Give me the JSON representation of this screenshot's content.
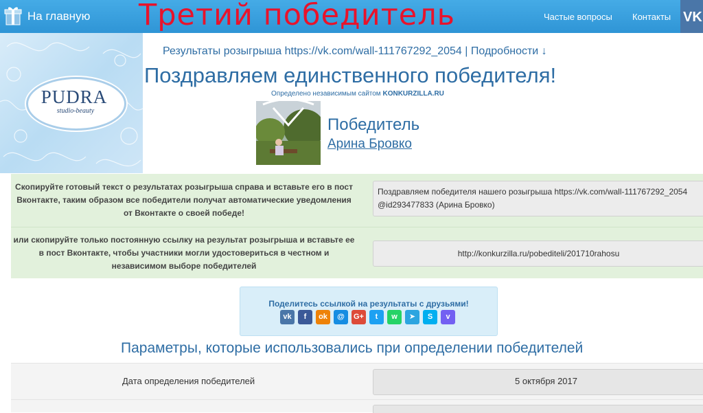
{
  "overlay_title": "Третий победитель",
  "nav": {
    "home_label": "На главную",
    "faq_label": "Частые вопросы",
    "contacts_label": "Контакты"
  },
  "banner": {
    "brand": "PUDRA",
    "subtitle": "studio-beauty"
  },
  "results": {
    "prefix": "Результаты розыгрыша",
    "link": "https://vk.com/wall-111767292_2054",
    "separator": "|",
    "details": "Подробности ↓"
  },
  "congrats": "Поздравляем единственного победителя!",
  "determined": {
    "text": "Определено независимым сайтом",
    "site": "KONKURZILLA.RU"
  },
  "winner": {
    "label": "Победитель",
    "name": "Арина Бровко"
  },
  "copy": {
    "instruction_1": "Скопируйте готовый текст о результатах розыгрыша справа и вставьте его в пост Вконтакте, таким образом все победители получат автоматические уведомления от Вконтакте о своей победе!",
    "text_value": "Поздравляем победителя нашего розыгрыша https://vk.com/wall-111767292_2054 @id293477833 (Арина Бровко)",
    "instruction_2": "или скопируйте только постоянную ссылку на результат розыгрыша и вставьте ее в пост Вконтакте, чтобы участники могли удостовериться в честном и независимом выборе победителей",
    "link_value": "http://konkurzilla.ru/pobediteli/201710rahosu"
  },
  "share": {
    "title": "Поделитесь ссылкой на результаты с друзьями!",
    "icons": [
      {
        "name": "vk-icon",
        "glyph": "vk",
        "color": "#4a76a8"
      },
      {
        "name": "facebook-icon",
        "glyph": "f",
        "color": "#3b5998"
      },
      {
        "name": "odnoklassniki-icon",
        "glyph": "ok",
        "color": "#ee8208"
      },
      {
        "name": "moimir-icon",
        "glyph": "@",
        "color": "#168de2"
      },
      {
        "name": "googleplus-icon",
        "glyph": "G+",
        "color": "#dd4b39"
      },
      {
        "name": "twitter-icon",
        "glyph": "t",
        "color": "#1da1f2"
      },
      {
        "name": "whatsapp-icon",
        "glyph": "w",
        "color": "#25d366"
      },
      {
        "name": "telegram-icon",
        "glyph": "➤",
        "color": "#2ca5e0"
      },
      {
        "name": "skype-icon",
        "glyph": "S",
        "color": "#00aff0"
      },
      {
        "name": "viber-icon",
        "glyph": "v",
        "color": "#7360f2"
      }
    ]
  },
  "params": {
    "title": "Параметры, которые использовались при определении победителей",
    "date_label": "Дата определения победителей",
    "date_value": "5 октября 2017"
  },
  "colors": {
    "topbar": "#3aa0dd",
    "accent_text": "#2e6da4",
    "overlay_red": "#e8132b",
    "copy_bg": "#e2f1dc",
    "share_bg": "#d9eef9"
  }
}
